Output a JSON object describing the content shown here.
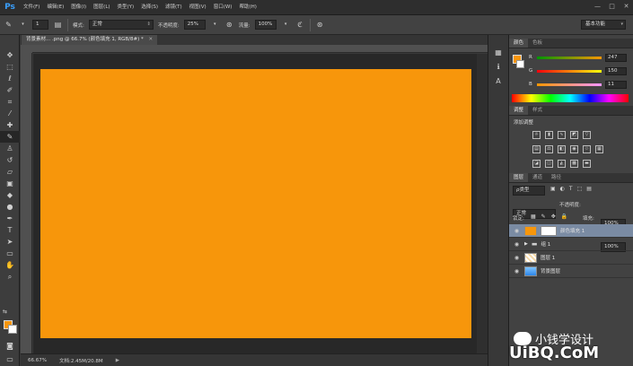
{
  "app": {
    "logo": "Ps"
  },
  "menu": [
    "文件(F)",
    "编辑(E)",
    "图像(I)",
    "图层(L)",
    "类型(Y)",
    "选择(S)",
    "滤镜(T)",
    "视图(V)",
    "窗口(W)",
    "帮助(H)"
  ],
  "window_controls": [
    "—",
    "□",
    "✕"
  ],
  "options": {
    "brush_size": "1",
    "mode_label": "模式:",
    "mode_value": "正常",
    "opacity_label": "不透明度:",
    "opacity_value": "25%",
    "flow_label": "流量:",
    "flow_value": "100%",
    "workspace": "基本功能"
  },
  "document": {
    "tab_title": "背景素材... .png @ 66.7% (颜色填充 1, RGB/8#) *",
    "canvas_color": "#f7960b",
    "zoom": "66.67%",
    "doc_size": "文档:2.45M/20.8M"
  },
  "color_panel": {
    "tabs": [
      "颜色",
      "色板"
    ],
    "fg": "#f7960b",
    "bg": "#ffffff",
    "channels": [
      {
        "label": "R",
        "value": "247",
        "level": 0.969
      },
      {
        "label": "G",
        "value": "150",
        "level": 0.588
      },
      {
        "label": "B",
        "value": "11",
        "level": 0.043
      }
    ]
  },
  "adjust_panel": {
    "tabs": [
      "调整",
      "样式"
    ],
    "title": "添加调整"
  },
  "layers_panel": {
    "tabs": [
      "图层",
      "通道",
      "路径"
    ],
    "kind_label": "ρ类型",
    "blend": "正常",
    "opacity_label": "不透明度:",
    "opacity_value": "100%",
    "lock_label": "锁定:",
    "fill_label": "填充:",
    "fill_value": "100%",
    "layers": [
      {
        "name": "颜色填充 1",
        "selected": true
      },
      {
        "name": "组 1",
        "selected": false
      },
      {
        "name": "图层 1",
        "selected": false
      },
      {
        "name": "背景图层",
        "selected": false
      }
    ]
  },
  "watermark": {
    "text": "小钱学设计",
    "site": "UiBQ.CoM"
  },
  "colors": {
    "accent": "#3aa0ff",
    "selection": "#7a8ba3"
  }
}
